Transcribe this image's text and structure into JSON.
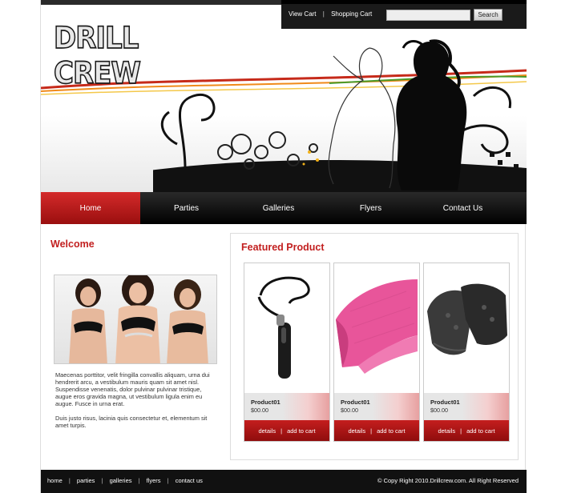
{
  "header": {
    "logo_text": "DRILL CREW",
    "view_cart": "View Cart",
    "shopping_cart": "Shopping Cart",
    "separator": "|",
    "search_button": "Search",
    "search_value": ""
  },
  "nav": {
    "items": [
      "Home",
      "Parties",
      "Galleries",
      "Flyers",
      "Contact Us"
    ],
    "active": "Home"
  },
  "welcome": {
    "title": "Welcome",
    "paragraph1": "Maecenas porttitor, velit fringilla convallis aliquam, urna dui hendrerit arcu, a vestibulum mauris quam sit amet nisl. Suspendisse venenatis, dolor pulvinar pulvinar tristique, augue eros gravida magna, ut vestibulum ligula enim eu augue. Fusce in urna erat.",
    "paragraph2": "Duis justo risus, lacinia quis consectetur et, elementum sit amet turpis."
  },
  "featured": {
    "title": "Featured Product",
    "products": [
      {
        "name": "Product01",
        "price": "$00.00",
        "details": "details",
        "add": "add to cart",
        "sep": "|",
        "image": "whistle-icon"
      },
      {
        "name": "Product01",
        "price": "$00.00",
        "details": "details",
        "add": "add to cart",
        "sep": "|",
        "image": "pink-towel-icon"
      },
      {
        "name": "Product01",
        "price": "$00.00",
        "details": "details",
        "add": "add to cart",
        "sep": "|",
        "image": "gloves-icon"
      }
    ]
  },
  "footer": {
    "links": [
      "home",
      "parties",
      "galleries",
      "flyers",
      "contact us"
    ],
    "separator": "|",
    "copyright": "© Copy Right 2010.Drillcrew.com. All Right Reserved"
  },
  "colors": {
    "accent_red": "#c21f1f",
    "nav_black": "#111111",
    "pink": "#e8559a"
  }
}
